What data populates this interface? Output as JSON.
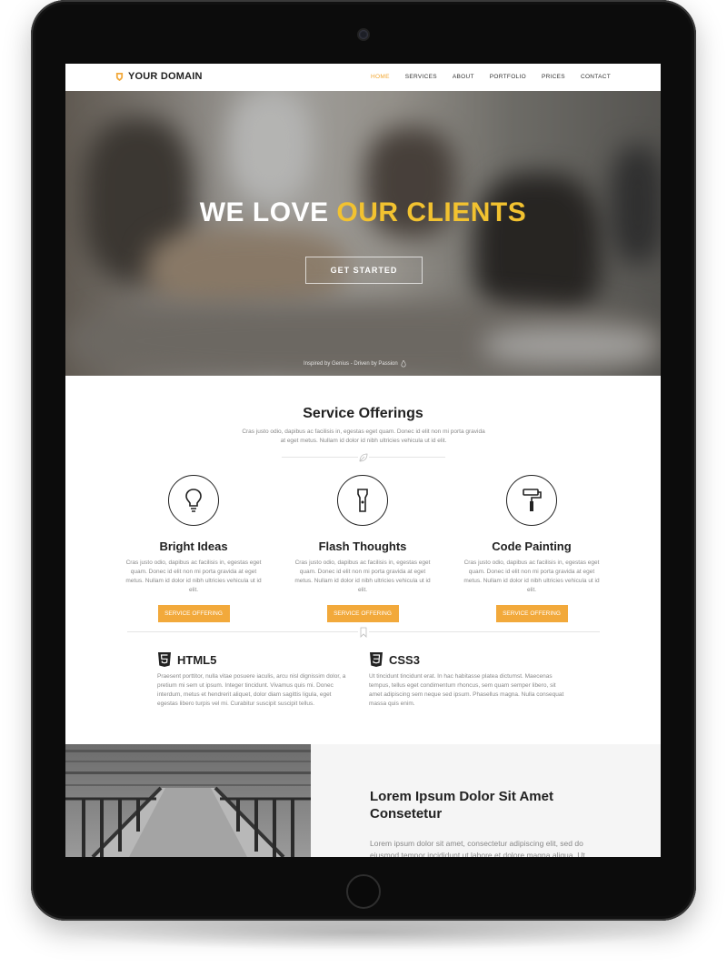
{
  "nav": {
    "brand": "YOUR DOMAIN",
    "links": [
      "HOME",
      "SERVICES",
      "ABOUT",
      "PORTFOLIO",
      "PRICES",
      "CONTACT"
    ],
    "active_link": "HOME"
  },
  "hero": {
    "title_part1": "WE LOVE",
    "title_part2": "OUR CLIENTS",
    "button": "GET STARTED",
    "tagline": "Inspired by Genius - Driven by Passion"
  },
  "services": {
    "title": "Service Offerings",
    "description": "Cras justo odio, dapibus ac facilisis in, egestas eget quam. Donec id elit non mi porta gravida at eget metus. Nullam id dolor id nibh ultricies vehicula ut id elit.",
    "items": [
      {
        "icon": "lightbulb-icon",
        "title": "Bright Ideas",
        "description": "Cras justo odio, dapibus ac facilisis in, egestas eget quam. Donec id elit non mi porta gravida at eget metus. Nullam id dolor id nibh ultricies vehicula ut id elit.",
        "button": "SERVICE OFFERING"
      },
      {
        "icon": "flashlight-icon",
        "title": "Flash Thoughts",
        "description": "Cras justo odio, dapibus ac facilisis in, egestas eget quam. Donec id elit non mi porta gravida at eget metus. Nullam id dolor id nibh ultricies vehicula ut id elit.",
        "button": "SERVICE OFFERING"
      },
      {
        "icon": "paint-roller-icon",
        "title": "Code Painting",
        "description": "Cras justo odio, dapibus ac facilisis in, egestas eget quam. Donec id elit non mi porta gravida at eget metus. Nullam id dolor id nibh ultricies vehicula ut id elit.",
        "button": "SERVICE OFFERING"
      }
    ]
  },
  "tech": [
    {
      "icon": "html5-icon",
      "title": "HTML5",
      "description": "Praesent porttitor, nulla vitae posuere iaculis, arcu nisl dignissim dolor, a pretium mi sem ut ipsum. Integer tincidunt. Vivamus quis mi. Donec interdum, metus et hendrerit aliquet, dolor diam sagittis ligula, eget egestas libero turpis vel mi. Curabitur suscipit suscipit tellus."
    },
    {
      "icon": "css3-icon",
      "title": "CSS3",
      "description": "Ut tincidunt tincidunt erat. In hac habitasse platea dictumst. Maecenas tempus, tellus eget condimentum rhoncus, sem quam semper libero, sit amet adipiscing sem neque sed ipsum. Phasellus magna. Nulla consequat massa quis enim."
    }
  ],
  "about": {
    "title": "Lorem Ipsum Dolor Sit Amet Consetetur",
    "text": "Lorem ipsum dolor sit amet, consectetur adipiscing elit, sed do eiusmod tempor incididunt ut labore et dolore magna aliqua. Ut"
  },
  "colors": {
    "accent": "#f2a93b",
    "hero_highlight": "#f2c230",
    "nav_active": "#f2a62e",
    "tablet_frame": "#0c0c0c"
  }
}
